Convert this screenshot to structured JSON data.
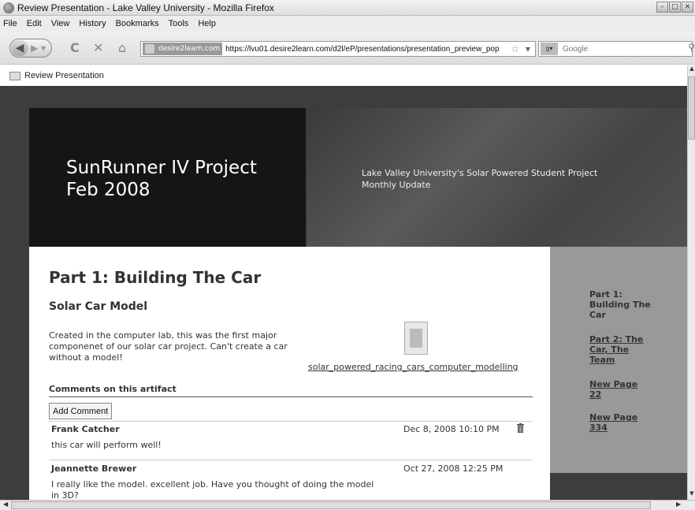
{
  "window": {
    "title": "Review Presentation - Lake Valley University - Mozilla Firefox",
    "controls": [
      "–",
      "□",
      "✕"
    ]
  },
  "menu": [
    "File",
    "Edit",
    "View",
    "History",
    "Bookmarks",
    "Tools",
    "Help"
  ],
  "nav": {
    "site_badge": "desire2learn.com",
    "url": "https://lvu01.desire2learn.com/d2l/eP/presentations/presentation_preview_pop",
    "search_placeholder": "Google"
  },
  "tab": {
    "label": "Review Presentation"
  },
  "banner": {
    "title_line1": "SunRunner IV Project",
    "title_line2": "Feb 2008",
    "subtitle_line1": "Lake Valley University's Solar Powered Student Project",
    "subtitle_line2": "Monthly Update"
  },
  "main": {
    "heading": "Part 1: Building The Car",
    "subheading": "Solar Car Model",
    "description": "Created in the computer lab, this was the first major componenet of our solar car project. Can't create a car without a model!",
    "artifact_link": "solar_powered_racing_cars_computer_modelling",
    "comments_heading": "Comments on this artifact",
    "add_comment": "Add Comment",
    "comments": [
      {
        "author": "Frank Catcher",
        "date": "Dec 8, 2008 10:10 PM",
        "text": "this car will perform well!"
      },
      {
        "author": "Jeannette Brewer",
        "date": "Oct 27, 2008 12:25 PM",
        "text_line1": "I really like the model. excellent job. Have you thought of doing the model",
        "text_line2": "in 3D?"
      }
    ]
  },
  "sidebar": {
    "items": [
      {
        "line1": "Part 1:",
        "line2": "Building The",
        "line3": "Car"
      },
      {
        "line1": "Part 2: The",
        "line2": "Car, The",
        "line3": "Team"
      },
      {
        "line1": "New Page",
        "line2": "22"
      },
      {
        "line1": "New Page",
        "line2": "334"
      }
    ]
  },
  "colors": {
    "page_bg": "#3d3d3d",
    "sidebar_bg": "#999999",
    "banner_dark": "#151515"
  }
}
